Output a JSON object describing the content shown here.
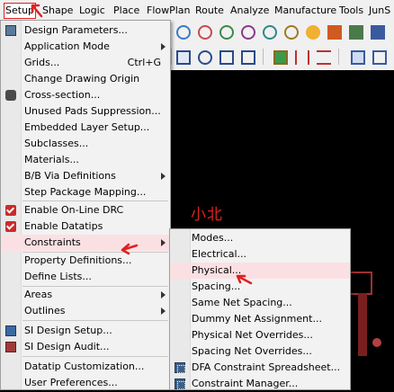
{
  "menubar": {
    "items": [
      "Setup",
      "Shape",
      "Logic",
      "Place",
      "FlowPlan",
      "Route",
      "Analyze",
      "Manufacture",
      "Tools",
      "JunS"
    ]
  },
  "canvas": {
    "label": "小北"
  },
  "setup_menu": {
    "items": [
      {
        "label": "Design Parameters...",
        "has_icon": true
      },
      {
        "label": "Application Mode",
        "submenu": true
      },
      {
        "label": "Grids...",
        "accelerator": "Ctrl+G"
      },
      {
        "label": "Change Drawing Origin"
      },
      {
        "label": "Cross-section...",
        "has_icon": true
      },
      {
        "label": "Unused Pads Suppression..."
      },
      {
        "label": "Embedded Layer Setup..."
      },
      {
        "label": "Subclasses..."
      },
      {
        "label": "Materials..."
      },
      {
        "label": "B/B Via Definitions",
        "submenu": true
      },
      {
        "label": "Step Package Mapping..."
      },
      {
        "label": "Enable On-Line DRC",
        "checked": true
      },
      {
        "label": "Enable Datatips",
        "checked": true
      },
      {
        "label": "Constraints",
        "submenu": true,
        "highlighted": true
      },
      {
        "label": "Property Definitions..."
      },
      {
        "label": "Define Lists..."
      },
      {
        "label": "Areas",
        "submenu": true
      },
      {
        "label": "Outlines",
        "submenu": true
      },
      {
        "label": "SI Design Setup...",
        "has_icon": true
      },
      {
        "label": "SI Design Audit...",
        "has_icon": true
      },
      {
        "label": "Datatip Customization..."
      },
      {
        "label": "User Preferences..."
      }
    ]
  },
  "constraints_submenu": {
    "items": [
      {
        "label": "Modes..."
      },
      {
        "label": "Electrical..."
      },
      {
        "label": "Physical...",
        "highlighted": true
      },
      {
        "label": "Spacing..."
      },
      {
        "label": "Same Net Spacing..."
      },
      {
        "label": "Dummy Net Assignment..."
      },
      {
        "label": "Physical Net Overrides..."
      },
      {
        "label": "Spacing Net Overrides..."
      },
      {
        "label": "DFA Constraint Spreadsheet...",
        "has_icon": true
      },
      {
        "label": "Constraint Manager...",
        "has_icon": true
      }
    ]
  },
  "colors": {
    "annotation_red": "#e02020",
    "highlight": "#fbe0e3",
    "canvas_bg": "#000000"
  }
}
